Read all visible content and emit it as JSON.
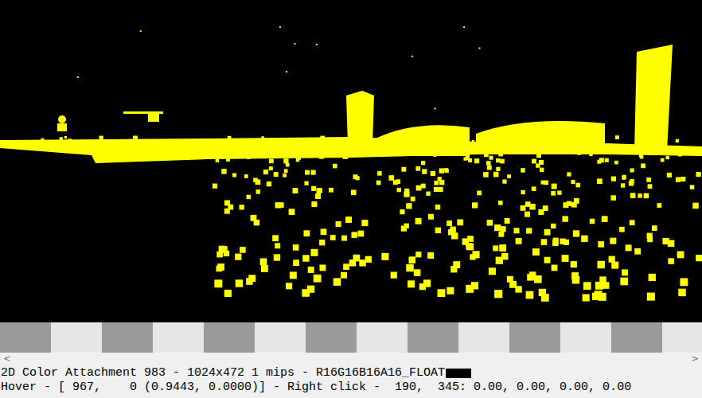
{
  "texture_view": {
    "background": "#000000",
    "content_color": "#ffff00"
  },
  "scrollbar": {
    "left_arrow": "<",
    "right_arrow": ">"
  },
  "status_bar": {
    "line1": "2D Color Attachment 983 - 1024x472 1 mips - R16G16B16A16_FLOAT",
    "swatch_color": "#000000",
    "line2": "Hover - [ 967,    0 (0.9443, 0.0000)] - Right click -  190,  345: 0.00, 0.00, 0.00, 0.00"
  }
}
